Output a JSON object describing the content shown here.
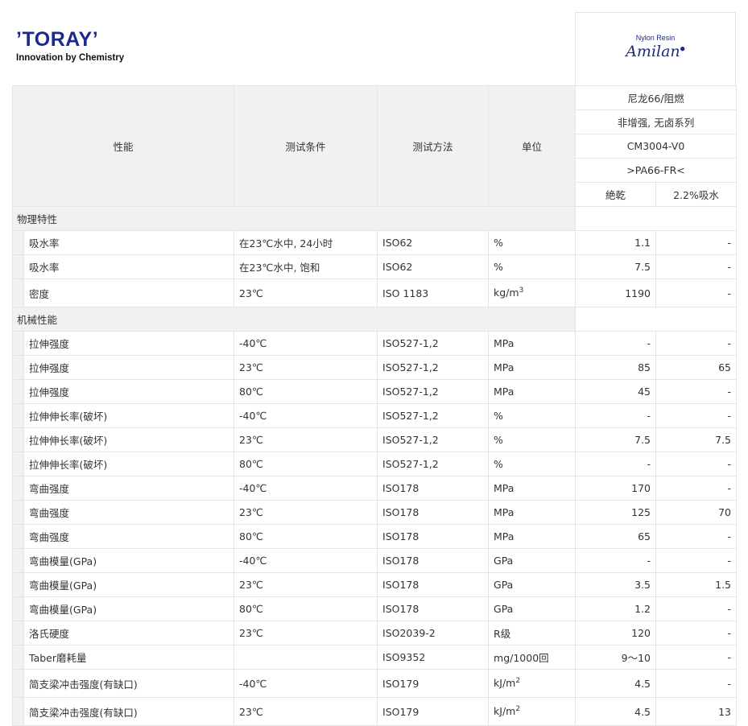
{
  "brand": {
    "toray_name": "’TORAY’",
    "toray_tagline": "Innovation by Chemistry",
    "product_line_small": "Nylon Resin",
    "product_line_name": "Amilan"
  },
  "table": {
    "headers": {
      "property": "性能",
      "condition": "测试条件",
      "method": "测试方法",
      "unit": "单位",
      "product_series": "尼龙66/阻燃",
      "product_type": "非增强, 无卤系列",
      "product_grade": "CM3004-V0",
      "product_code": ">PA66-FR<",
      "col_dry": "絶乾",
      "col_wet": "2.2%吸水"
    },
    "sections": [
      {
        "title": "物理特性",
        "rows": [
          {
            "property": "吸水率",
            "condition": "在23℃水中, 24小时",
            "method": "ISO62",
            "unit": "%",
            "unit_sup": "",
            "dry": "1.1",
            "wet": "-"
          },
          {
            "property": "吸水率",
            "condition": "在23℃水中, 饱和",
            "method": "ISO62",
            "unit": "%",
            "unit_sup": "",
            "dry": "7.5",
            "wet": "-"
          },
          {
            "property": "密度",
            "condition": "23℃",
            "method": "ISO 1183",
            "unit": "kg/m",
            "unit_sup": "3",
            "dry": "1190",
            "wet": "-"
          }
        ]
      },
      {
        "title": "机械性能",
        "rows": [
          {
            "property": "拉伸强度",
            "condition": "-40℃",
            "method": "ISO527-1,2",
            "unit": "MPa",
            "unit_sup": "",
            "dry": "-",
            "wet": "-"
          },
          {
            "property": "拉伸强度",
            "condition": "23℃",
            "method": "ISO527-1,2",
            "unit": "MPa",
            "unit_sup": "",
            "dry": "85",
            "wet": "65"
          },
          {
            "property": "拉伸强度",
            "condition": "80℃",
            "method": "ISO527-1,2",
            "unit": "MPa",
            "unit_sup": "",
            "dry": "45",
            "wet": "-"
          },
          {
            "property": "拉伸伸长率(破坏)",
            "condition": "-40℃",
            "method": "ISO527-1,2",
            "unit": "%",
            "unit_sup": "",
            "dry": "-",
            "wet": "-"
          },
          {
            "property": "拉伸伸长率(破坏)",
            "condition": "23℃",
            "method": "ISO527-1,2",
            "unit": "%",
            "unit_sup": "",
            "dry": "7.5",
            "wet": "7.5"
          },
          {
            "property": "拉伸伸长率(破坏)",
            "condition": "80℃",
            "method": "ISO527-1,2",
            "unit": "%",
            "unit_sup": "",
            "dry": "-",
            "wet": "-"
          },
          {
            "property": "弯曲强度",
            "condition": "-40℃",
            "method": "ISO178",
            "unit": "MPa",
            "unit_sup": "",
            "dry": "170",
            "wet": "-"
          },
          {
            "property": "弯曲强度",
            "condition": "23℃",
            "method": "ISO178",
            "unit": "MPa",
            "unit_sup": "",
            "dry": "125",
            "wet": "70"
          },
          {
            "property": "弯曲强度",
            "condition": "80℃",
            "method": "ISO178",
            "unit": "MPa",
            "unit_sup": "",
            "dry": "65",
            "wet": "-"
          },
          {
            "property": "弯曲模量(GPa)",
            "condition": "-40℃",
            "method": "ISO178",
            "unit": "GPa",
            "unit_sup": "",
            "dry": "-",
            "wet": "-"
          },
          {
            "property": "弯曲模量(GPa)",
            "condition": "23℃",
            "method": "ISO178",
            "unit": "GPa",
            "unit_sup": "",
            "dry": "3.5",
            "wet": "1.5"
          },
          {
            "property": "弯曲模量(GPa)",
            "condition": "80℃",
            "method": "ISO178",
            "unit": "GPa",
            "unit_sup": "",
            "dry": "1.2",
            "wet": "-"
          },
          {
            "property": "洛氏硬度",
            "condition": "23℃",
            "method": "ISO2039-2",
            "unit": "R级",
            "unit_sup": "",
            "dry": "120",
            "wet": "-"
          },
          {
            "property": "Taber磨耗量",
            "condition": "",
            "method": "ISO9352",
            "unit": "mg/1000回",
            "unit_sup": "",
            "dry": "9～10",
            "wet": "-"
          },
          {
            "property": "简支梁冲击强度(有缺口)",
            "condition": "-40℃",
            "method": "ISO179",
            "unit": "kJ/m",
            "unit_sup": "2",
            "dry": "4.5",
            "wet": "-"
          },
          {
            "property": "简支梁冲击强度(有缺口)",
            "condition": "23℃",
            "method": "ISO179",
            "unit": "kJ/m",
            "unit_sup": "2",
            "dry": "4.5",
            "wet": "13"
          }
        ]
      }
    ]
  }
}
